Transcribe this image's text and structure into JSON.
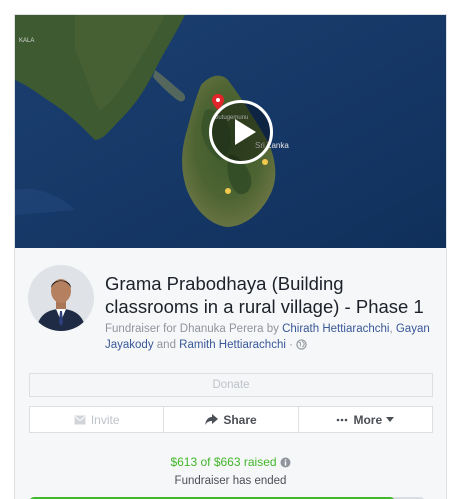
{
  "fundraiser": {
    "title": "Grama Prabodhaya (Building classrooms in a rural village) - Phase 1",
    "byline_prefix": "Fundraiser for Dhanuka Perera by ",
    "organizers": [
      "Chirath Hettiarachchi",
      "Gayan Jayakody",
      "Ramith Hettiarachchi"
    ],
    "separator_comma": ",",
    "separator_and": " and ",
    "separator_dot": " · "
  },
  "map": {
    "labels": [
      "KALA",
      "Sri Lanka"
    ],
    "pin_label": "Dutugemunu"
  },
  "buttons": {
    "donate": "Donate",
    "invite": "Invite",
    "share": "Share",
    "more": "More"
  },
  "progress": {
    "raised_text": "$613 of $663 raised",
    "status": "Fundraiser has ended",
    "fraction": 0.9246
  },
  "colors": {
    "accent_green": "#42b72a",
    "link_blue": "#385898",
    "pin_red": "#e0262a"
  },
  "icons": [
    "play-icon",
    "globe-icon",
    "envelope-icon",
    "share-arrow-icon",
    "ellipsis-icon",
    "chevron-down-icon",
    "info-icon",
    "map-pin-icon"
  ]
}
